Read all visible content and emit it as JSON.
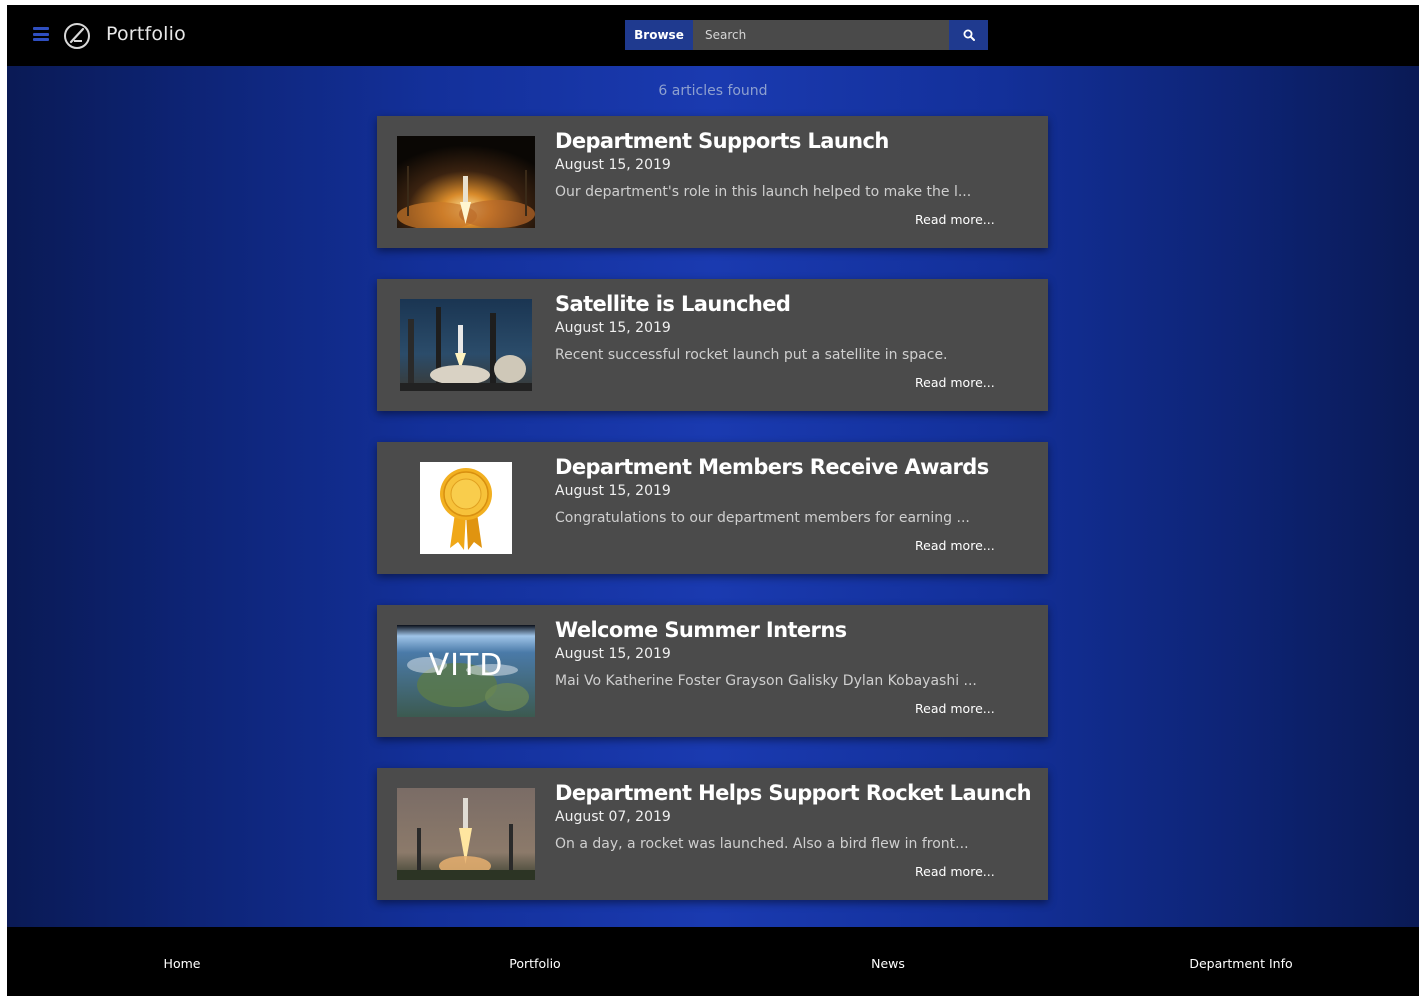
{
  "header": {
    "brand": "Portfolio",
    "browse_label": "Browse",
    "search_placeholder": "Search",
    "icons": [
      "menu-icon",
      "logo-icon",
      "search-icon"
    ],
    "accent_color": "#1f3a8f"
  },
  "main": {
    "count_text": "6 articles found",
    "articles": [
      {
        "title": "Department Supports Launch",
        "date": "August 15, 2019",
        "excerpt": "Our department's role in this launch helped to make the l...",
        "read_more": "Read more..."
      },
      {
        "title": "Satellite is Launched",
        "date": "August 15, 2019",
        "excerpt": "Recent successful rocket launch put a satellite in space.",
        "read_more": "Read more..."
      },
      {
        "title": "Department Members Receive Awards",
        "date": "August 15, 2019",
        "excerpt": "Congratulations to our department members for earning ...",
        "read_more": "Read more..."
      },
      {
        "title": "Welcome Summer Interns",
        "date": "August 15, 2019",
        "excerpt": "Mai Vo Katherine Foster Grayson Galisky Dylan Kobayashi ...",
        "read_more": "Read more...",
        "thumb_text": "VITD"
      },
      {
        "title": "Department Helps Support Rocket Launch",
        "date": "August 07, 2019",
        "excerpt": "On a day, a rocket was launched. Also a bird flew in front...",
        "read_more": "Read more..."
      }
    ]
  },
  "footer": {
    "links": [
      "Home",
      "Portfolio",
      "News",
      "Department Info"
    ]
  }
}
